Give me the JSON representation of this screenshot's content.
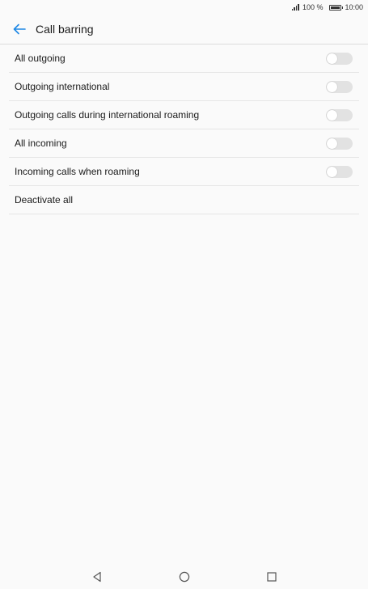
{
  "status_bar": {
    "battery_text": "100 %",
    "time": "10:00",
    "icons": [
      "signal-icon",
      "battery-icon"
    ]
  },
  "app_bar": {
    "title": "Call barring",
    "back_icon": "arrow-back-icon",
    "accent_color": "#1e88e5"
  },
  "settings": {
    "items": [
      {
        "label": "All outgoing",
        "toggle": "off"
      },
      {
        "label": "Outgoing international",
        "toggle": "off"
      },
      {
        "label": "Outgoing calls during international roaming",
        "toggle": "off"
      },
      {
        "label": "All incoming",
        "toggle": "off"
      },
      {
        "label": "Incoming calls when roaming",
        "toggle": "off"
      },
      {
        "label": "Deactivate all",
        "toggle": null
      }
    ]
  },
  "nav_bar": {
    "icons": [
      "back-triangle-icon",
      "home-circle-icon",
      "recents-square-icon"
    ]
  }
}
